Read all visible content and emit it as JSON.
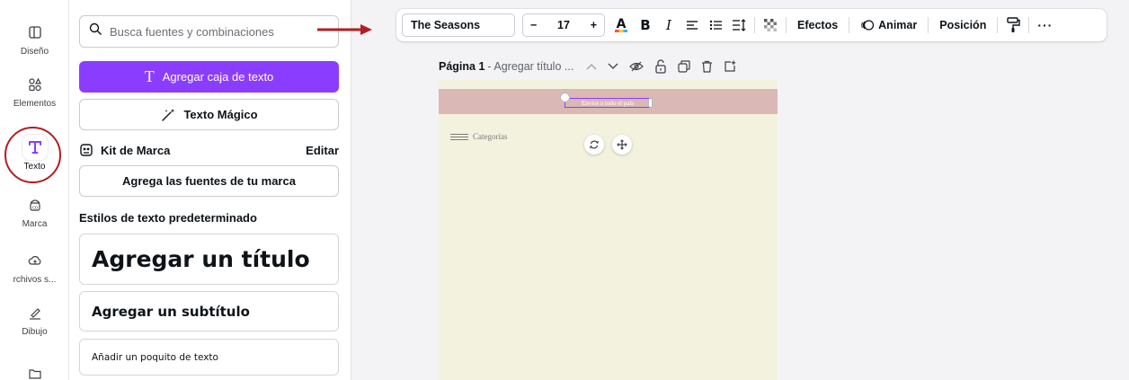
{
  "rail": {
    "items": [
      {
        "label": "Diseño",
        "icon": "layout-icon"
      },
      {
        "label": "Elementos",
        "icon": "shapes-icon"
      },
      {
        "label": "Texto",
        "icon": "text-icon"
      },
      {
        "label": "Marca",
        "icon": "brand-icon"
      },
      {
        "label": "rchivos s...",
        "icon": "cloud-upload-icon"
      },
      {
        "label": "Dibujo",
        "icon": "draw-icon"
      },
      {
        "label": "",
        "icon": "folder-icon"
      }
    ]
  },
  "panel": {
    "search_placeholder": "Busca fuentes y combinaciones",
    "add_textbox": "Agregar caja de texto",
    "magic_text": "Texto Mágico",
    "kit_title": "Kit de Marca",
    "kit_edit": "Editar",
    "brand_fonts": "Agrega las fuentes de tu marca",
    "default_styles": "Estilos de texto predeterminado",
    "heading": "Agregar un título",
    "subheading": "Agregar un subtítulo",
    "body": "Añadir un poquito de texto"
  },
  "toolbar": {
    "font": "The Seasons",
    "size": "17",
    "minus": "−",
    "plus": "+",
    "effects": "Efectos",
    "animate": "Animar",
    "position": "Posición",
    "more": "···"
  },
  "page": {
    "name": "Página 1",
    "title": "- Agregar título ..."
  },
  "canvas": {
    "selected_text": "Envíos a todo el país",
    "category": "Categorías",
    "colors": {
      "background": "#f3f2de",
      "band": "#d9b8b5",
      "accent": "#8b3dff"
    }
  }
}
